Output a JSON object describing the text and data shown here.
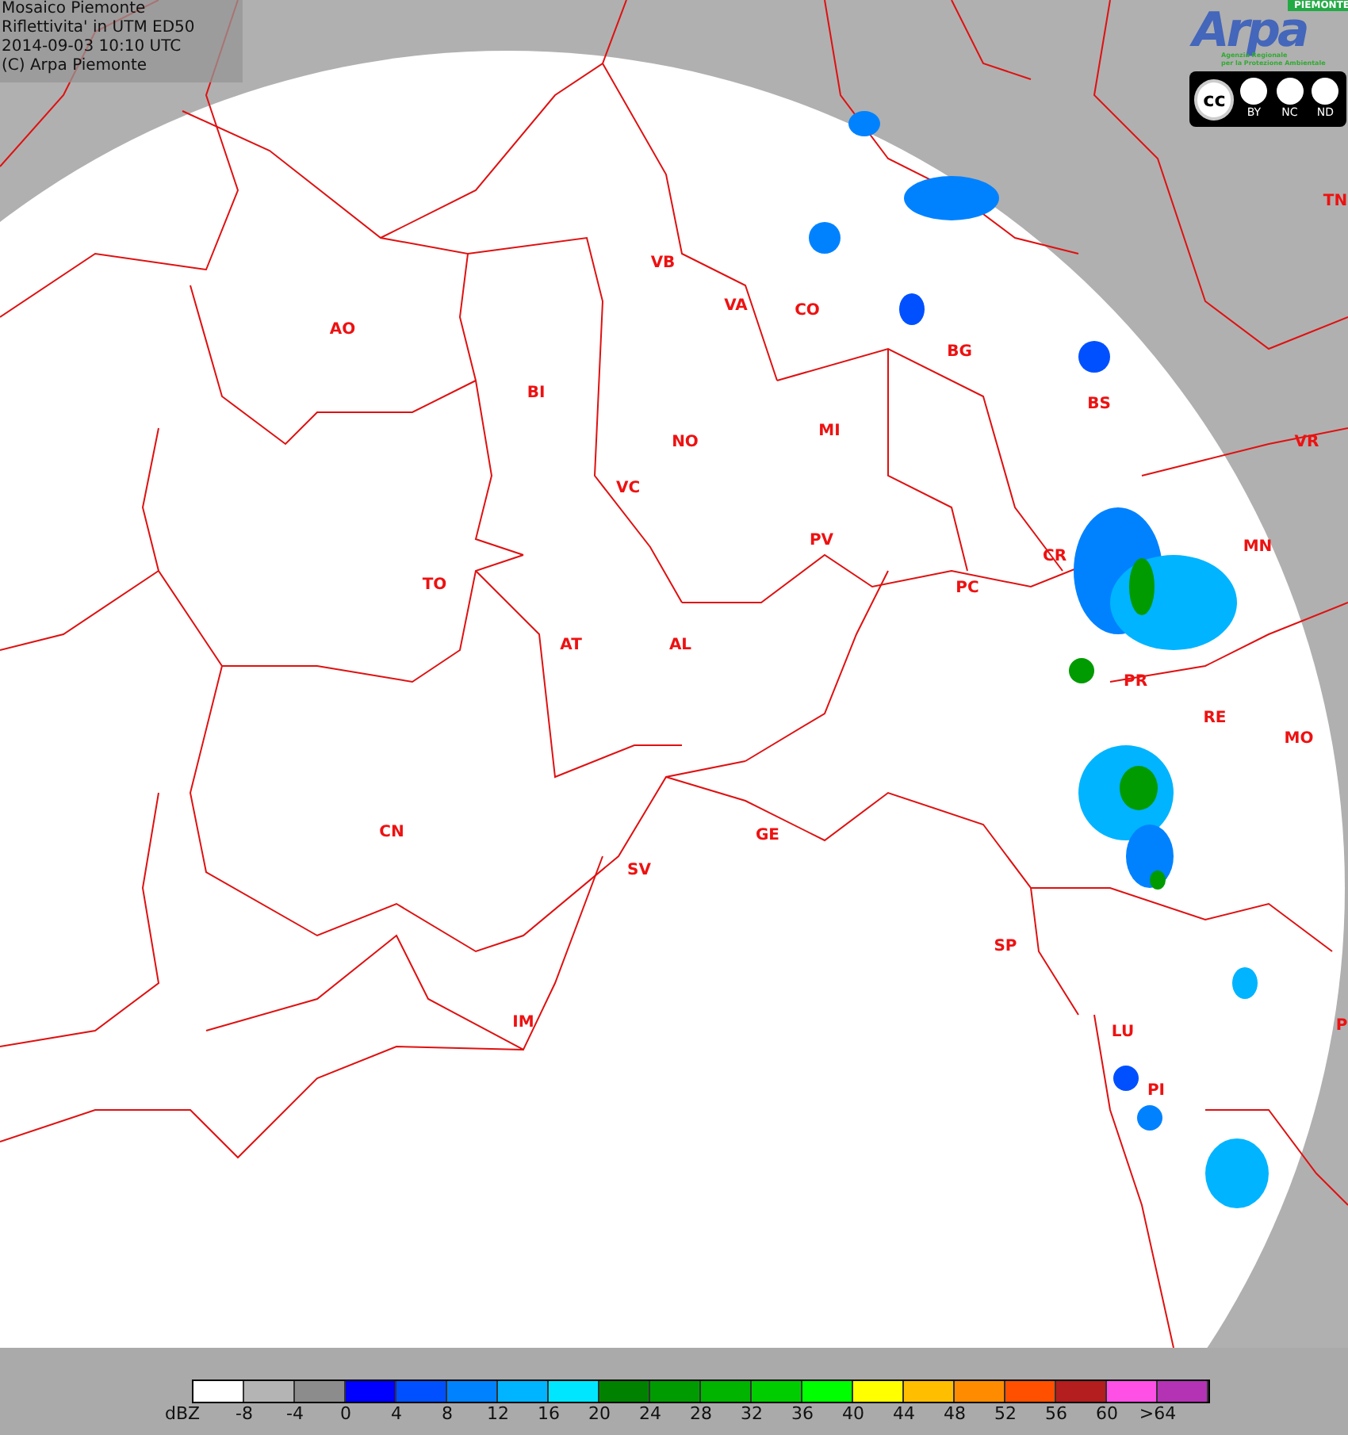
{
  "header": {
    "lines": [
      "Mosaico Piemonte",
      "Riflettivita' in UTM ED50",
      "2014-09-03 10:10 UTC",
      "(C) Arpa Piemonte"
    ]
  },
  "logo": {
    "name": "Arpa",
    "badge": "PIEMONTE",
    "subtitle": [
      "Agenzia Regionale",
      "per la Protezione Ambientale"
    ]
  },
  "license": {
    "mark": "cc",
    "terms": [
      "BY",
      "NC",
      "ND"
    ]
  },
  "map": {
    "places": [
      "AO",
      "VB",
      "VA",
      "CO",
      "BG",
      "BS",
      "BI",
      "NO",
      "MI",
      "VC",
      "PV",
      "CR",
      "MN",
      "VR",
      "TN",
      "TO",
      "AT",
      "AL",
      "PC",
      "PR",
      "RE",
      "MO",
      "CN",
      "GE",
      "SV",
      "SP",
      "IM",
      "LU",
      "PI",
      "P"
    ]
  },
  "legend": {
    "unit": "dBZ",
    "ticks": [
      "-8",
      "-4",
      "0",
      "4",
      "8",
      "12",
      "16",
      "20",
      "24",
      "28",
      "32",
      "36",
      "40",
      "44",
      "48",
      "52",
      "56",
      "60",
      ">64"
    ],
    "swatches": [
      {
        "color": "#ffffff"
      },
      {
        "color": "#b4b4b4"
      },
      {
        "color": "#8c8c8c"
      },
      {
        "color": "#0000ff"
      },
      {
        "color": "#0050ff"
      },
      {
        "color": "#0082ff"
      },
      {
        "color": "#00b4ff"
      },
      {
        "color": "#00e6ff"
      },
      {
        "color": "#008200"
      },
      {
        "color": "#009b00"
      },
      {
        "color": "#00b400"
      },
      {
        "color": "#00cd00"
      },
      {
        "color": "#00ff00"
      },
      {
        "color": "#ffff00"
      },
      {
        "color": "#ffbe00"
      },
      {
        "color": "#ff8c00"
      },
      {
        "color": "#ff5000"
      },
      {
        "color": "#b41e1e"
      },
      {
        "color": "#ff50e6"
      },
      {
        "color": "#b432b4"
      }
    ]
  }
}
